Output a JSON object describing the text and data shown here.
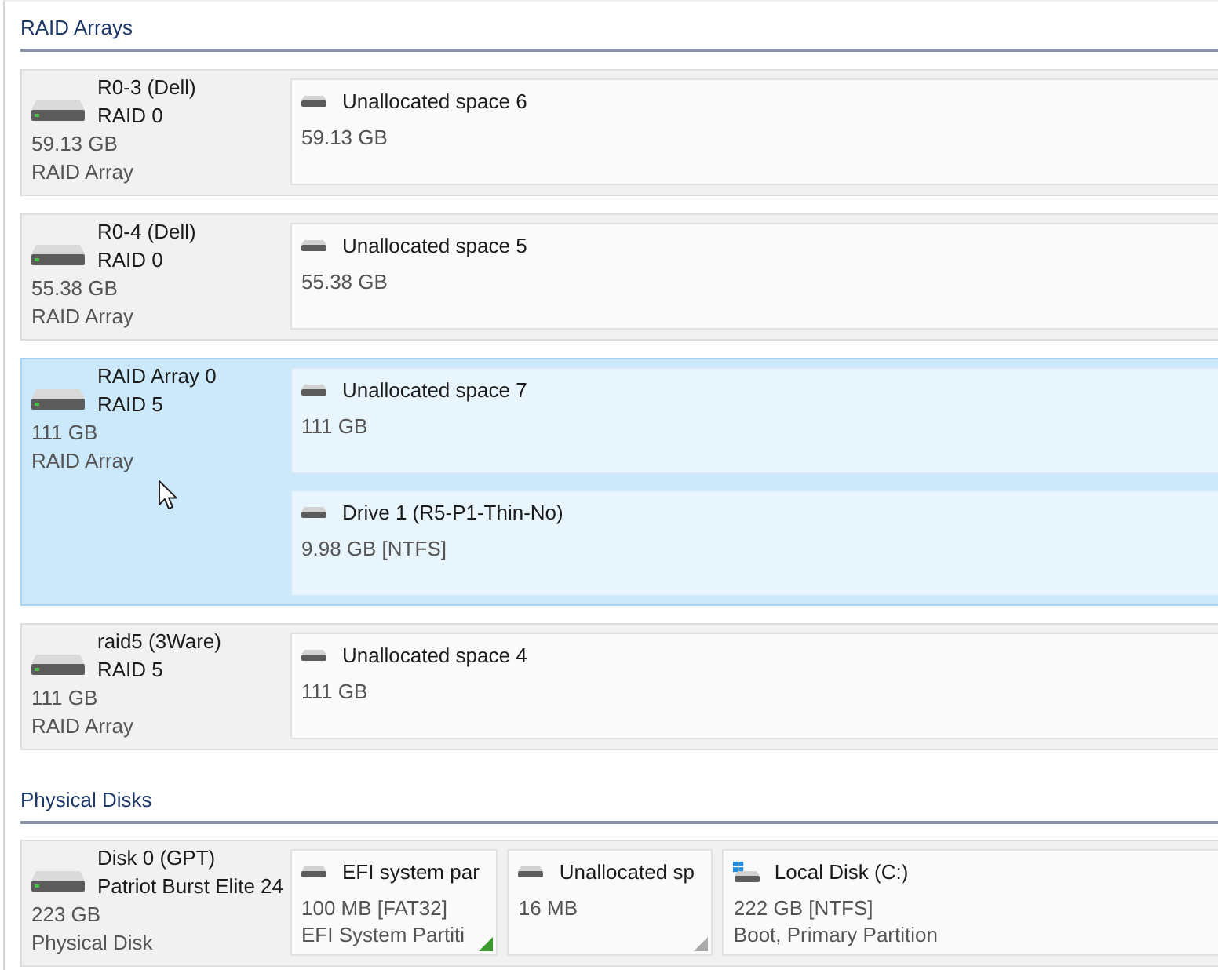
{
  "sections": [
    {
      "title": "RAID Arrays",
      "kind": "raid",
      "items": [
        {
          "name": "R0-3 (Dell)",
          "subtitle": "RAID 0",
          "size": "59.13 GB",
          "type": "RAID Array",
          "selected": false,
          "partitions": [
            {
              "kind": "drive",
              "name": "Unallocated space 6",
              "size": "59.13 GB"
            }
          ]
        },
        {
          "name": "R0-4 (Dell)",
          "subtitle": "RAID 0",
          "size": "55.38 GB",
          "type": "RAID Array",
          "selected": false,
          "partitions": [
            {
              "kind": "drive",
              "name": "Unallocated space 5",
              "size": "55.38 GB"
            }
          ]
        },
        {
          "name": "RAID Array 0",
          "subtitle": "RAID 5",
          "size": "111 GB",
          "type": "RAID Array",
          "selected": true,
          "partitions": [
            {
              "kind": "drive",
              "name": "Unallocated space 7",
              "size": "111 GB"
            },
            {
              "kind": "drive",
              "name": "Drive 1 (R5-P1-Thin-No)",
              "size": "9.98 GB [NTFS]"
            }
          ]
        },
        {
          "name": "raid5 (3Ware)",
          "subtitle": "RAID 5",
          "size": "111 GB",
          "type": "RAID Array",
          "selected": false,
          "partitions": [
            {
              "kind": "drive",
              "name": "Unallocated space 4",
              "size": "111 GB"
            }
          ]
        }
      ]
    },
    {
      "title": "Physical Disks",
      "kind": "disk",
      "items": [
        {
          "name": "Disk 0 (GPT)",
          "subtitle": "Patriot Burst Elite 24",
          "size": "223 GB",
          "type": "Physical Disk",
          "selected": false,
          "partitions": [
            {
              "kind": "drive",
              "name": "EFI system par",
              "size": "100 MB [FAT32]",
              "detail": "EFI System Partiti",
              "color": "#3c9a2c"
            },
            {
              "kind": "drive",
              "name": "Unallocated sp",
              "size": "16 MB",
              "color": "#a9a9a9"
            },
            {
              "kind": "system-drive",
              "name": "Local Disk (C:)",
              "size": "222 GB [NTFS]",
              "detail": "Boot, Primary Partition"
            }
          ]
        }
      ]
    }
  ]
}
